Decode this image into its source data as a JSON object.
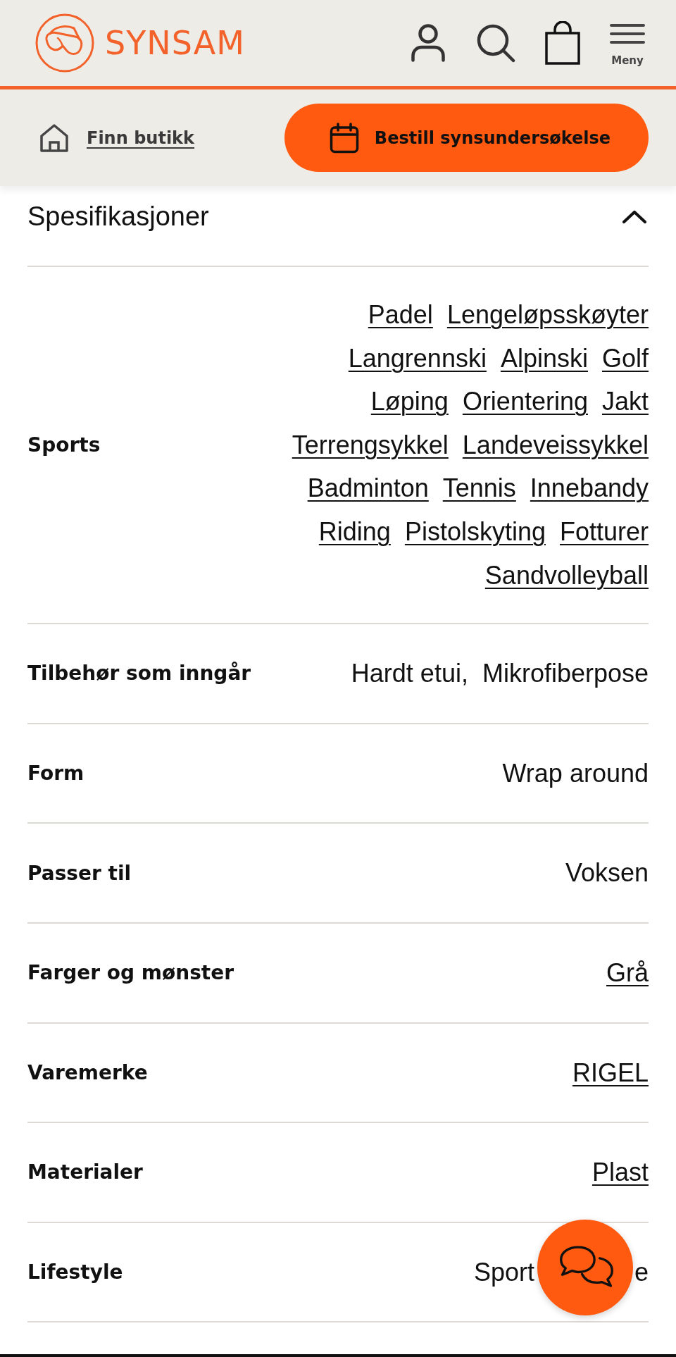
{
  "header": {
    "brand": "SYNSAM",
    "menu_label": "Meny"
  },
  "action_bar": {
    "store_link": "Finn butikk",
    "book_button": "Bestill synsundersøkelse"
  },
  "specifications": {
    "title": "Spesifikasjoner",
    "expanded": true,
    "rows": [
      {
        "label": "Sports",
        "kind": "links",
        "values": [
          "Padel",
          "Lengeløpsskøyter",
          "Langrennski",
          "Alpinski",
          "Golf",
          "Løping",
          "Orientering",
          "Jakt",
          "Terrengsykkel",
          "Landeveissykkel",
          "Badminton",
          "Tennis",
          "Innebandy",
          "Riding",
          "Pistolskyting",
          "Fotturer",
          "Sandvolleyball"
        ]
      },
      {
        "label": "Tilbehør som inngår",
        "kind": "text",
        "values": [
          "Hardt etui,",
          "Mikrofiberpose"
        ]
      },
      {
        "label": "Form",
        "kind": "text",
        "values": [
          "Wrap around"
        ]
      },
      {
        "label": "Passer til",
        "kind": "text",
        "values": [
          "Voksen"
        ]
      },
      {
        "label": "Farger og mønster",
        "kind": "links",
        "values": [
          "Grå"
        ]
      },
      {
        "label": "Varemerke",
        "kind": "links",
        "values": [
          "RIGEL"
        ]
      },
      {
        "label": "Materialer",
        "kind": "links",
        "values": [
          "Plast"
        ]
      },
      {
        "label": "Lifestyle",
        "kind": "covered",
        "values": [
          "Sport",
          "e"
        ]
      }
    ]
  }
}
